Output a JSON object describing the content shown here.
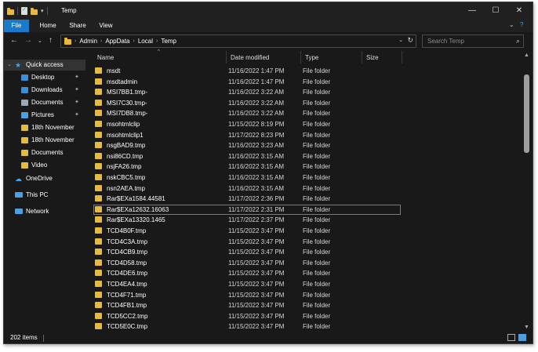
{
  "window": {
    "title": "Temp",
    "controls": {
      "minimize": "—",
      "maximize": "☐",
      "close": "✕"
    }
  },
  "ribbon": {
    "tabs": [
      "File",
      "Home",
      "Share",
      "View"
    ],
    "collapse_glyph": "⌄",
    "help_glyph": "?"
  },
  "address": {
    "back": "←",
    "forward": "→",
    "recent": "⌄",
    "up": "↑",
    "crumbs": [
      "Admin",
      "AppData",
      "Local",
      "Temp"
    ],
    "dropdown": "⌄",
    "refresh": "↻",
    "search_placeholder": "Search Temp",
    "search_icon": "⌕"
  },
  "nav": {
    "quick_access": "Quick access",
    "items": [
      {
        "label": "Desktop",
        "icon": "desktop-icon",
        "color": "#3a8fd8",
        "pinned": true
      },
      {
        "label": "Downloads",
        "icon": "downloads-icon",
        "color": "#3a8fd8",
        "pinned": true
      },
      {
        "label": "Documents",
        "icon": "documents-icon",
        "color": "#9aa8b8",
        "pinned": true
      },
      {
        "label": "Pictures",
        "icon": "pictures-icon",
        "color": "#4aa0e0",
        "pinned": true
      },
      {
        "label": "18th November",
        "icon": "folder-icon",
        "color": "#e8b93a",
        "pinned": false
      },
      {
        "label": "18th November",
        "icon": "folder-icon",
        "color": "#e8b93a",
        "pinned": false
      },
      {
        "label": "Documents",
        "icon": "folder-icon",
        "color": "#e8b93a",
        "pinned": false
      },
      {
        "label": "Video",
        "icon": "folder-icon",
        "color": "#e8b93a",
        "pinned": false
      }
    ],
    "onedrive": "OneDrive",
    "thispc": "This PC",
    "network": "Network",
    "pin_glyph": "📌"
  },
  "columns": {
    "name": "Name",
    "date": "Date modified",
    "type": "Type",
    "size": "Size"
  },
  "files": [
    {
      "name": "msdt",
      "date": "11/16/2022 1:47 PM",
      "type": "File folder"
    },
    {
      "name": "msdtadmin",
      "date": "11/16/2022 1:47 PM",
      "type": "File folder"
    },
    {
      "name": "MSI7BB1.tmp-",
      "date": "11/16/2022 3:22 AM",
      "type": "File folder"
    },
    {
      "name": "MSI7C30.tmp-",
      "date": "11/16/2022 3:22 AM",
      "type": "File folder"
    },
    {
      "name": "MSI7DB8.tmp-",
      "date": "11/16/2022 3:22 AM",
      "type": "File folder"
    },
    {
      "name": "msohtmlclip",
      "date": "11/15/2022 8:19 PM",
      "type": "File folder"
    },
    {
      "name": "msohtmlclip1",
      "date": "11/17/2022 8:23 PM",
      "type": "File folder"
    },
    {
      "name": "nsgBAD9.tmp",
      "date": "11/16/2022 3:23 AM",
      "type": "File folder"
    },
    {
      "name": "nsi86CD.tmp",
      "date": "11/16/2022 3:15 AM",
      "type": "File folder"
    },
    {
      "name": "nsjFA26.tmp",
      "date": "11/16/2022 3:15 AM",
      "type": "File folder"
    },
    {
      "name": "nskCBC5.tmp",
      "date": "11/16/2022 3:15 AM",
      "type": "File folder"
    },
    {
      "name": "nsn2AEA.tmp",
      "date": "11/16/2022 3:15 AM",
      "type": "File folder"
    },
    {
      "name": "Rar$EXa1584.44581",
      "date": "11/17/2022 2:36 PM",
      "type": "File folder"
    },
    {
      "name": "Rar$EXa12632.16063",
      "date": "11/17/2022 2:31 PM",
      "type": "File folder"
    },
    {
      "name": "Rar$EXa13320.1465",
      "date": "11/17/2022 2:37 PM",
      "type": "File folder"
    },
    {
      "name": "TCD4B0F.tmp",
      "date": "11/15/2022 3:47 PM",
      "type": "File folder"
    },
    {
      "name": "TCD4C3A.tmp",
      "date": "11/15/2022 3:47 PM",
      "type": "File folder"
    },
    {
      "name": "TCD4CB9.tmp",
      "date": "11/15/2022 3:47 PM",
      "type": "File folder"
    },
    {
      "name": "TCD4D58.tmp",
      "date": "11/15/2022 3:47 PM",
      "type": "File folder"
    },
    {
      "name": "TCD4DE6.tmp",
      "date": "11/15/2022 3:47 PM",
      "type": "File folder"
    },
    {
      "name": "TCD4EA4.tmp",
      "date": "11/15/2022 3:47 PM",
      "type": "File folder"
    },
    {
      "name": "TCD4F71.tmp",
      "date": "11/15/2022 3:47 PM",
      "type": "File folder"
    },
    {
      "name": "TCD4FB1.tmp",
      "date": "11/15/2022 3:47 PM",
      "type": "File folder"
    },
    {
      "name": "TCD5CC2.tmp",
      "date": "11/15/2022 3:47 PM",
      "type": "File folder"
    },
    {
      "name": "TCD5E0C.tmp",
      "date": "11/15/2022 3:47 PM",
      "type": "File folder"
    }
  ],
  "focused_row": 13,
  "status": {
    "count": "202 items"
  },
  "scroll": {
    "up": "▲",
    "down": "▼"
  },
  "colors": {
    "accent": "#1979ca",
    "folder": "#e8b93a",
    "background": "#191919"
  }
}
